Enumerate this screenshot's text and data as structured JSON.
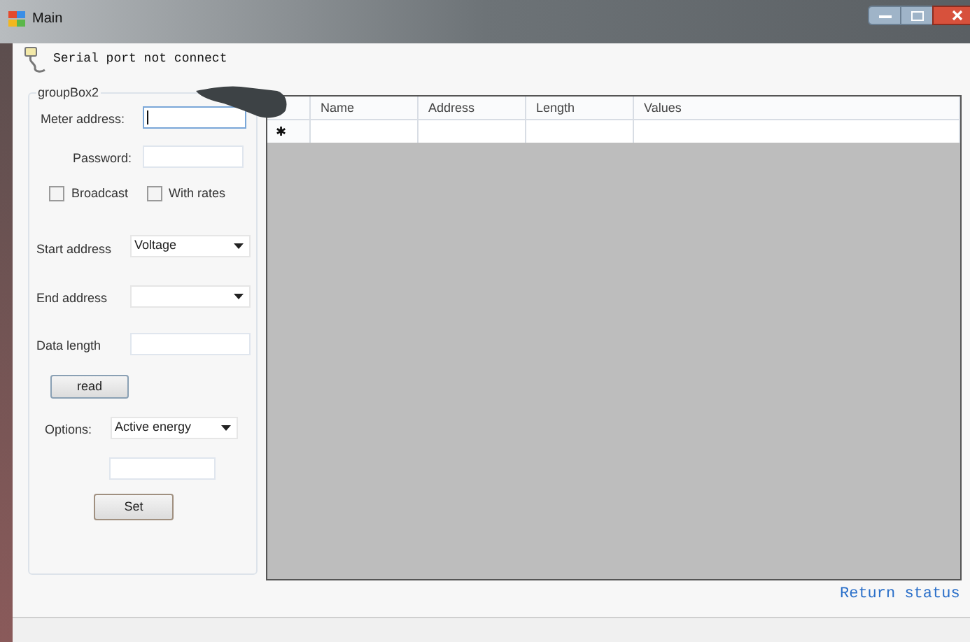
{
  "window": {
    "title": "Main"
  },
  "toolbar": {
    "status": "Serial port not connect"
  },
  "group_box": {
    "title": "groupBox2",
    "meter_address": {
      "label": "Meter address:",
      "focused": true
    },
    "password": {
      "label": "Password:"
    },
    "checkboxes": [
      {
        "label": "Broadcast",
        "checked": false
      },
      {
        "label": "With rates",
        "checked": false
      }
    ],
    "start_address": {
      "label": "Start address",
      "value": "Voltage"
    },
    "end_address": {
      "label": "End address"
    },
    "data_length": {
      "label": "Data length"
    },
    "read_button": "read",
    "options": {
      "label": "Options:",
      "value": "Active energy"
    },
    "set_button": "Set"
  },
  "grid": {
    "columns": [
      "Name",
      "Address",
      "Length",
      "Values"
    ],
    "new_row_marker": "✱"
  },
  "return_status": "Return status"
}
